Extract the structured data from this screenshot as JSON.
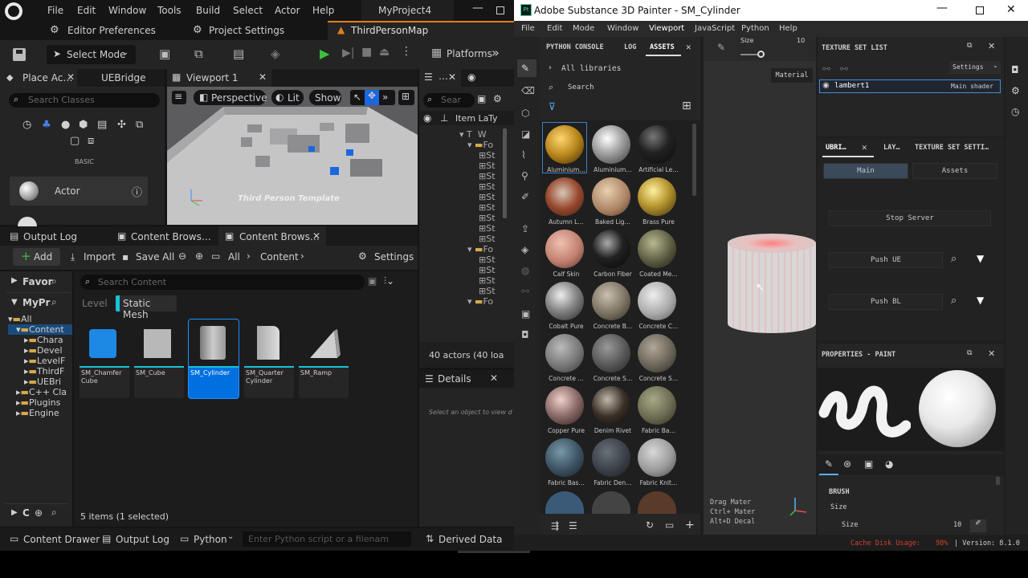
{
  "ue": {
    "menu": [
      "File",
      "Edit",
      "Window",
      "Tools",
      "Build",
      "Select",
      "Actor",
      "Help"
    ],
    "project": "MyProject4",
    "editor_prefs": "Editor Preferences",
    "project_settings": "Project Settings",
    "map_tab": "ThirdPersonMap",
    "select_mode": "Select Mode",
    "platforms": "Platforms",
    "tabs": {
      "place_actors": "Place Ac…",
      "uebridge": "UEBridge",
      "viewport": "Viewport 1"
    },
    "search_classes": "Search Classes",
    "basic": "BASIC",
    "actor": "Actor",
    "viewport": {
      "perspective": "Perspective",
      "lit": "Lit",
      "show": "Show",
      "template_text": "Third Person Template"
    },
    "outliner": {
      "search": "Sear",
      "item_label": "Item La",
      "type": "Ty",
      "rows": [
        "T",
        "W",
        "Fo",
        "St",
        "St",
        "St",
        "St",
        "St",
        "St",
        "St",
        "St",
        "St",
        "Fo",
        "St",
        "St",
        "St",
        "St",
        "Fo"
      ],
      "actors": "40 actors (40 loa"
    },
    "details": {
      "title": "Details",
      "hint": "Select an object to view d"
    },
    "bottom_tabs": {
      "output_log": "Output Log",
      "content_browser_1": "Content Brows…",
      "content_browser_2": "Content Brows…"
    },
    "cb": {
      "add": "Add",
      "import": "Import",
      "save_all": "Save All",
      "path_all": "All",
      "path_content": "Content",
      "settings": "Settings",
      "search": "Search Content",
      "favorites": "Favor",
      "myproject": "MyPr",
      "filter_level": "Level",
      "filter_static": "Static Mesh",
      "status": "5 items (1 selected)",
      "c_label": "C",
      "tree": [
        "All",
        "Content",
        "Chara",
        "Devel",
        "LevelF",
        "ThirdF",
        "UEBri",
        "C++ Cla",
        "Plugins",
        "Engine"
      ],
      "assets": [
        "SM_Chamfer Cube",
        "SM_Cube",
        "SM_Cylinder",
        "SM_Quarter Cylinder",
        "SM_Ramp"
      ]
    },
    "footer": {
      "content_drawer": "Content Drawer",
      "output_log": "Output Log",
      "python": "Python",
      "cmd_placeholder": "Enter Python script or a filenam",
      "derived": "Derived Data"
    }
  },
  "sp": {
    "title": "Adobe Substance 3D Painter - SM_Cylinder",
    "menu": [
      "File",
      "Edit",
      "Mode",
      "Window",
      "Viewport",
      "JavaScript",
      "Python",
      "Help"
    ],
    "tabs": [
      "PYTHON CONSOLE",
      "LOG",
      "ASSETS"
    ],
    "all_libraries": "All libraries",
    "search": "Search",
    "materials": [
      "Aluminium…",
      "Aluminium…",
      "Artificial Le…",
      "Autumn L…",
      "Baked Lig…",
      "Brass Pure",
      "Calf Skin",
      "Carbon Fiber",
      "Coated Me…",
      "Cobalt Pure",
      "Concrete B…",
      "Concrete C…",
      "Concrete …",
      "Concrete S…",
      "Concrete S…",
      "Copper Pure",
      "Denim Rivet",
      "Fabric Ba…",
      "Fabric Bas…",
      "Fabric Den…",
      "Fabric Knit…"
    ],
    "size_label": "Size",
    "size_value": "10",
    "material_btn": "Material",
    "hints": [
      "Drag Mater",
      "Ctrl+ Mater",
      "Alt+D Decal"
    ],
    "texture_set": {
      "title": "TEXTURE SET LIST",
      "settings": "Settings",
      "item": "lambert1",
      "shader": "Main shader"
    },
    "ubridge": {
      "tabs": [
        "UBRI…",
        "LAY…",
        "TEXTURE SET SETTI…"
      ],
      "main": "Main",
      "assets": "Assets",
      "stop": "Stop Server",
      "push_ue": "Push UE",
      "push_bl": "Push BL"
    },
    "properties": {
      "title": "PROPERTIES - PAINT",
      "brush": "BRUSH",
      "size": "Size",
      "size2": "Size",
      "size_val": "10"
    },
    "status": {
      "cache": "Cache Disk Usage:",
      "cache_val": "98%",
      "version": "| Version: 8.1.0"
    }
  }
}
